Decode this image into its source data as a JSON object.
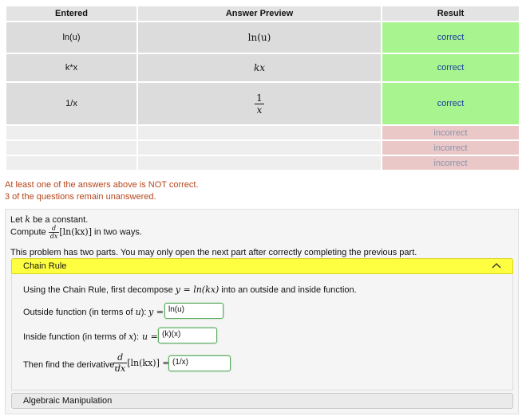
{
  "table": {
    "headers": [
      "Entered",
      "Answer Preview",
      "Result"
    ],
    "rows": [
      {
        "entered": "ln(u)",
        "preview": "ln(u)",
        "result": "correct"
      },
      {
        "entered": "k*x",
        "preview": "kx",
        "result": "correct"
      },
      {
        "entered": "1/x",
        "preview_num": "1",
        "preview_den": "x",
        "result": "correct"
      },
      {
        "entered": "",
        "preview": "",
        "result": "incorrect"
      },
      {
        "entered": "",
        "preview": "",
        "result": "incorrect"
      },
      {
        "entered": "",
        "preview": "",
        "result": "incorrect"
      }
    ]
  },
  "messages": {
    "not_correct": "At least one of the answers above is NOT correct.",
    "unanswered": "3 of the questions remain unanswered."
  },
  "problem": {
    "line1_pre": "Let ",
    "line1_var": "k",
    "line1_post": " be a constant.",
    "compute_pre": "Compute ",
    "d": "d",
    "dx": "dx",
    "compute_expr": "[ln(kx)]",
    "compute_post": " in two ways.",
    "parts_note": "This problem has two parts. You may only open the next part after correctly completing the previous part."
  },
  "part1": {
    "title": "Chain Rule",
    "instruction_pre": "Using the Chain Rule, first decompose ",
    "instruction_expr": "y = ln(kx)",
    "instruction_post": " into an outside and inside function.",
    "outside_label": "Outside function (in terms of ",
    "outside_var": "u",
    "outside_close": "):",
    "outside_lhs": "y =",
    "outside_value": "ln(u)",
    "inside_label": "Inside function (in terms of ",
    "inside_var": "x",
    "inside_close": "):",
    "inside_lhs": "u =",
    "inside_value": "(k)(x)",
    "deriv_label": "Then find the derivative,",
    "deriv_d": "d",
    "deriv_dx": "dx",
    "deriv_expr": "[ln(kx)] =",
    "deriv_value": "(1/x)"
  },
  "part2": {
    "title": "Algebraic Manipulation"
  },
  "icons": {
    "collapse": "chevron-up-icon"
  }
}
